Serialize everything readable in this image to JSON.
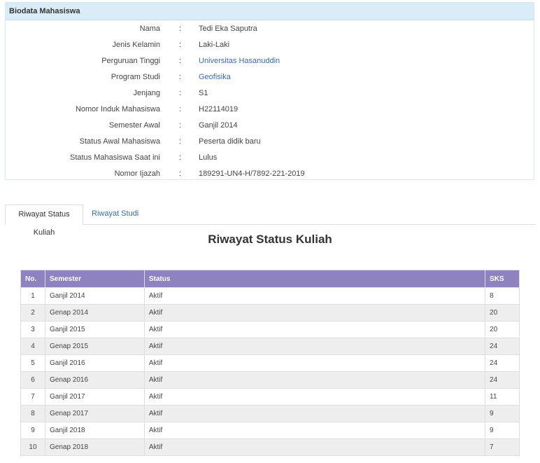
{
  "panel": {
    "title": "Biodata Mahasiswa"
  },
  "biodata": [
    {
      "label": "Nama",
      "value": "Tedi Eka Saputra",
      "link": false
    },
    {
      "label": "Jenis Kelamin",
      "value": "Laki-Laki",
      "link": false
    },
    {
      "label": "Perguruan Tinggi",
      "value": "Universitas Hasanuddin",
      "link": true
    },
    {
      "label": "Program Studi",
      "value": "Geofisika",
      "link": true
    },
    {
      "label": "Jenjang",
      "value": "S1",
      "link": false
    },
    {
      "label": "Nomor Induk Mahasiswa",
      "value": "H22114019",
      "link": false
    },
    {
      "label": "Semester Awal",
      "value": "Ganjil 2014",
      "link": false
    },
    {
      "label": "Status Awal Mahasiswa",
      "value": "Peserta didik baru",
      "link": false
    },
    {
      "label": "Status Mahasiswa Saat ini",
      "value": "Lulus",
      "link": false
    },
    {
      "label": "Nomor Ijazah",
      "value": "189291-UN4-H/7892-221-2019",
      "link": false
    }
  ],
  "colon": ":",
  "tabs": [
    {
      "label": "Riwayat Status Kuliah",
      "active": true
    },
    {
      "label": "Riwayat Studi",
      "active": false
    }
  ],
  "section_title": "Riwayat Status Kuliah",
  "table": {
    "headers": [
      "No.",
      "Semester",
      "Status",
      "SKS"
    ],
    "rows": [
      [
        "1",
        "Ganjil 2014",
        "Aktif",
        "8"
      ],
      [
        "2",
        "Genap 2014",
        "Aktif",
        "20"
      ],
      [
        "3",
        "Ganjil 2015",
        "Aktif",
        "20"
      ],
      [
        "4",
        "Genap 2015",
        "Aktif",
        "24"
      ],
      [
        "5",
        "Ganjil 2016",
        "Aktif",
        "24"
      ],
      [
        "6",
        "Genap 2016",
        "Aktif",
        "24"
      ],
      [
        "7",
        "Ganjil 2017",
        "Aktif",
        "11"
      ],
      [
        "8",
        "Genap 2017",
        "Aktif",
        "9"
      ],
      [
        "9",
        "Ganjil 2018",
        "Aktif",
        "9"
      ],
      [
        "10",
        "Genap 2018",
        "Aktif",
        "7"
      ]
    ]
  },
  "colors": {
    "header_bg": "#8e82bf",
    "panel_head_bg": "#d9ecf7",
    "link": "#3a6aa8"
  }
}
